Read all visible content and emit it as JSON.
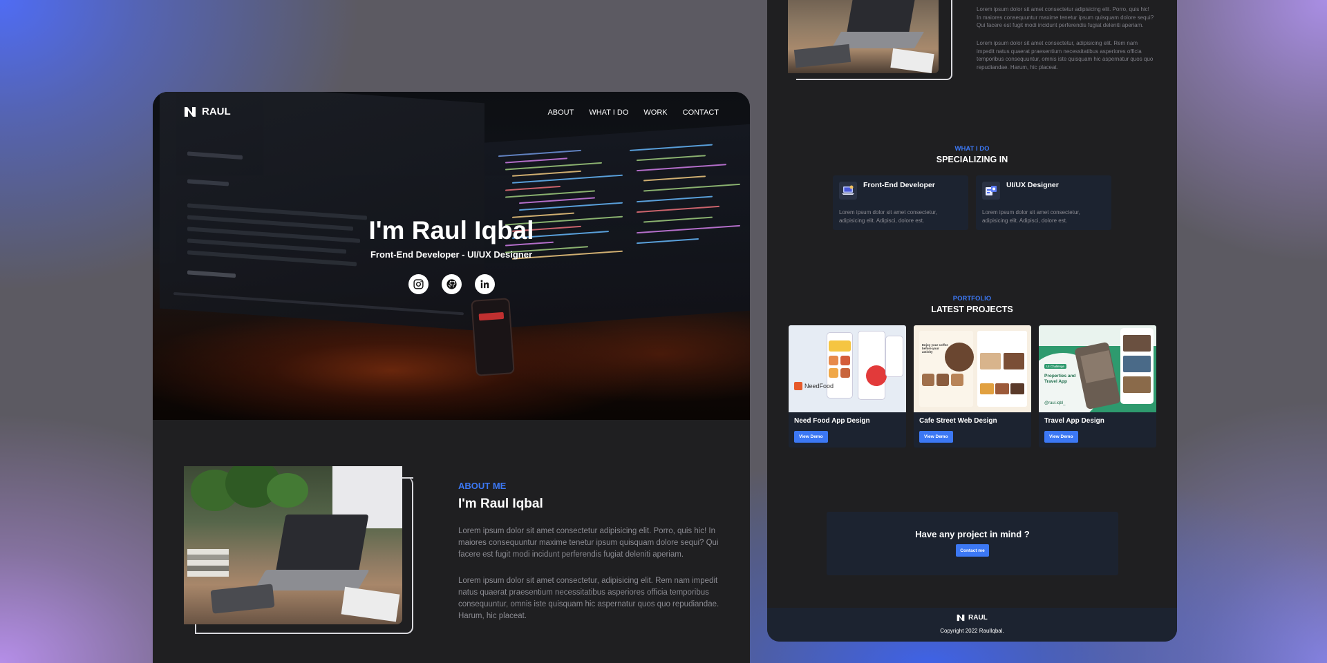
{
  "brand": {
    "name": "RAUL"
  },
  "nav": {
    "items": [
      "ABOUT",
      "WHAT I DO",
      "WORK",
      "CONTACT"
    ]
  },
  "hero": {
    "title": "I'm Raul Iqbal",
    "subtitle": "Front-End Developer - UI/UX Designer",
    "socials": [
      "instagram-icon",
      "github-icon",
      "linkedin-icon"
    ]
  },
  "about": {
    "eyebrow": "ABOUT ME",
    "title": "I'm Raul Iqbal",
    "paragraphs": [
      "Lorem ipsum dolor sit amet consectetur adipisicing elit. Porro, quis hic! In maiores consequuntur maxime tenetur ipsum quisquam dolore sequi? Qui facere est fugit modi incidunt perferendis fugiat deleniti aperiam.",
      "Lorem ipsum dolor sit amet consectetur, adipisicing elit. Rem nam impedit natus quaerat praesentium necessitatibus asperiores officia temporibus consequuntur, omnis iste quisquam hic aspernatur quos quo repudiandae. Harum, hic placeat."
    ]
  },
  "services": {
    "eyebrow": "WHAT I DO",
    "title": "SPECIALIZING IN",
    "items": [
      {
        "title": "Front-End Developer",
        "desc": "Lorem ipsum dolor sit amet consectetur, adipisicing elit. Adipisci, dolore est.",
        "icon": "code-laptop-icon"
      },
      {
        "title": "UI/UX Designer",
        "desc": "Lorem ipsum dolor sit amet consectetur, adipisicing elit. Adipisci, dolore est.",
        "icon": "design-tools-icon"
      }
    ]
  },
  "portfolio": {
    "eyebrow": "PORTFOLIO",
    "title": "LATEST PROJECTS",
    "projects": [
      {
        "title": "Need Food App Design",
        "button": "View Demo",
        "thumb_label": "NeedFood"
      },
      {
        "title": "Cafe Street Web Design",
        "button": "View Demo",
        "thumb_label": "Enjoy your coffee before your activity"
      },
      {
        "title": "Travel App Design",
        "button": "View Demo",
        "thumb_label": "Properties and Travel App",
        "thumb_badge": "UI Challenge",
        "thumb_handle": "@raul.iqbl_"
      }
    ]
  },
  "cta": {
    "title": "Have any project in mind ?",
    "button": "Contact me"
  },
  "footer": {
    "copyright": "Copyright 2022 RaulIqbal."
  },
  "colors": {
    "accent": "#3c78f4",
    "surface": "#1f1f21",
    "card": "#1c2330"
  }
}
